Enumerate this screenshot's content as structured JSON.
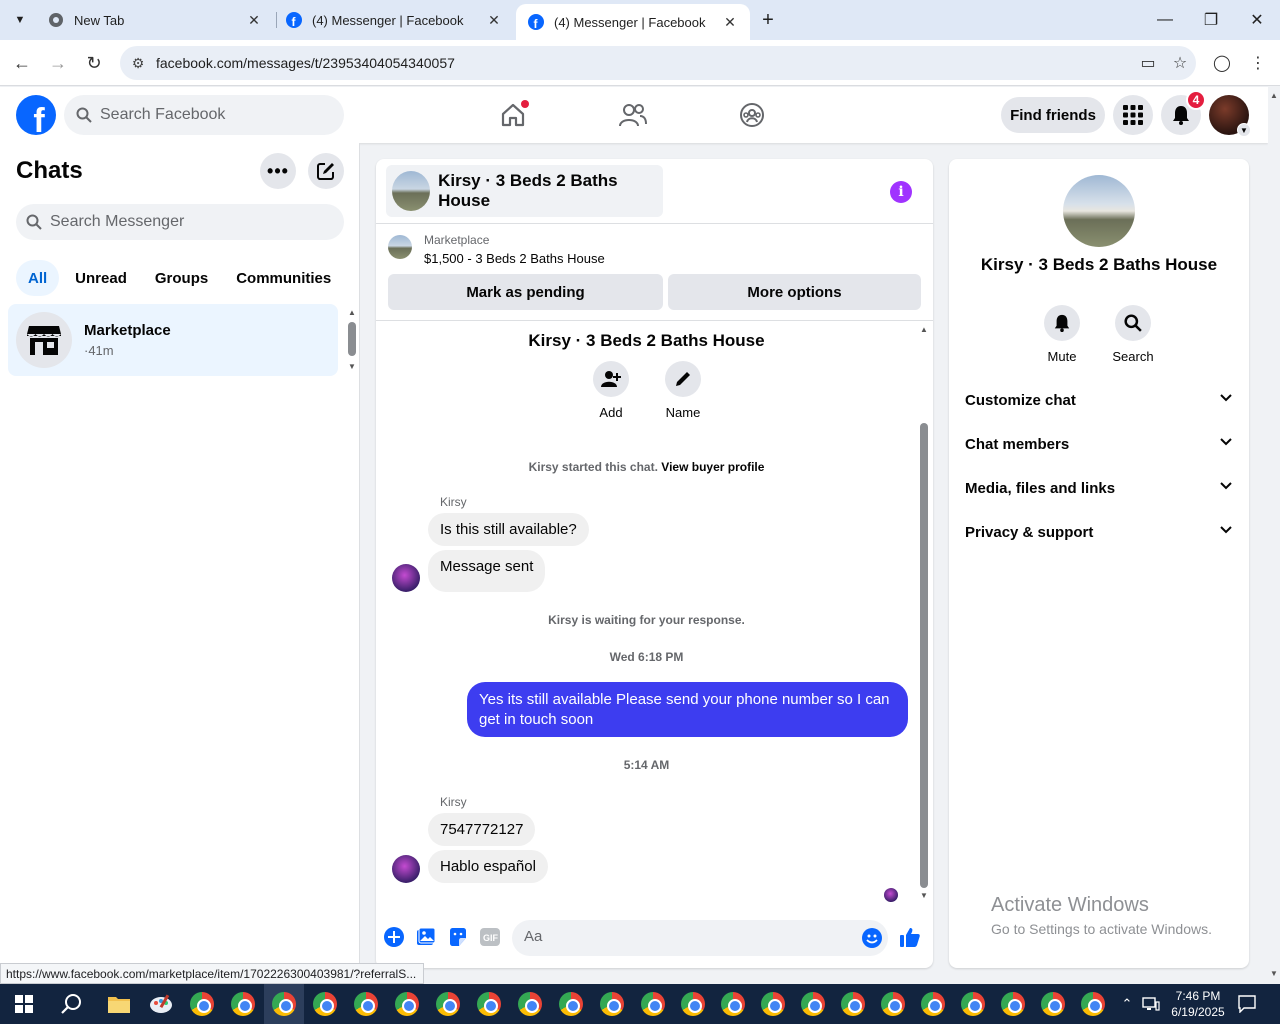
{
  "browser": {
    "tabs": [
      {
        "title": "New Tab",
        "active": false
      },
      {
        "title": "(4) Messenger | Facebook",
        "active": false
      },
      {
        "title": "(4) Messenger | Facebook",
        "active": true
      }
    ],
    "new_tab_glyph": "+",
    "url": "facebook.com/messages/t/23953404054340057",
    "status_link": "https://www.facebook.com/marketplace/item/1702226300403981/?referralS..."
  },
  "fb": {
    "search_placeholder": "Search Facebook",
    "find_friends": "Find friends",
    "notification_count": "4",
    "brand_color": "#0866ff"
  },
  "sidebar": {
    "title": "Chats",
    "search_placeholder": "Search Messenger",
    "filters": [
      "All",
      "Unread",
      "Groups",
      "Communities"
    ],
    "active_filter": "All",
    "chats": [
      {
        "name": "Marketplace",
        "time": "·41m"
      }
    ]
  },
  "conversation": {
    "title": "Kirsy · 3 Beds 2 Baths House",
    "listing": {
      "label": "Marketplace",
      "price_title": "$1,500 - 3 Beds 2 Baths House"
    },
    "mark_pending": "Mark as pending",
    "more_options": "More options",
    "thread_title": "Kirsy · 3 Beds 2 Baths House",
    "thread_actions": [
      {
        "label": "Add",
        "icon": "add-person-icon"
      },
      {
        "label": "Name",
        "icon": "pencil-icon"
      }
    ],
    "started_text": "Kirsy started this chat.",
    "view_buyer": "View buyer profile",
    "messages": {
      "sender1": "Kirsy",
      "m1": "Is this still available?",
      "m2": "Message sent",
      "waiting": "Kirsy is waiting for your response.",
      "time1": "Wed 6:18 PM",
      "out1": "Yes its still available Please send your phone number so I can get in touch soon",
      "time2": "5:14 AM",
      "sender2": "Kirsy",
      "m3": "7547772127",
      "m4": "Hablo español"
    },
    "composer_placeholder": "Aa",
    "outgoing_color": "#3d3df0"
  },
  "info_panel": {
    "name": "Kirsy · 3 Beds 2 Baths House",
    "actions": [
      {
        "label": "Mute",
        "icon": "bell-icon"
      },
      {
        "label": "Search",
        "icon": "search-icon"
      }
    ],
    "sections": [
      "Customize chat",
      "Chat members",
      "Media, files and links",
      "Privacy & support"
    ]
  },
  "watermark": {
    "line1": "Activate Windows",
    "line2": "Go to Settings to activate Windows."
  },
  "taskbar": {
    "time": "7:46 PM",
    "date": "6/19/2025"
  }
}
